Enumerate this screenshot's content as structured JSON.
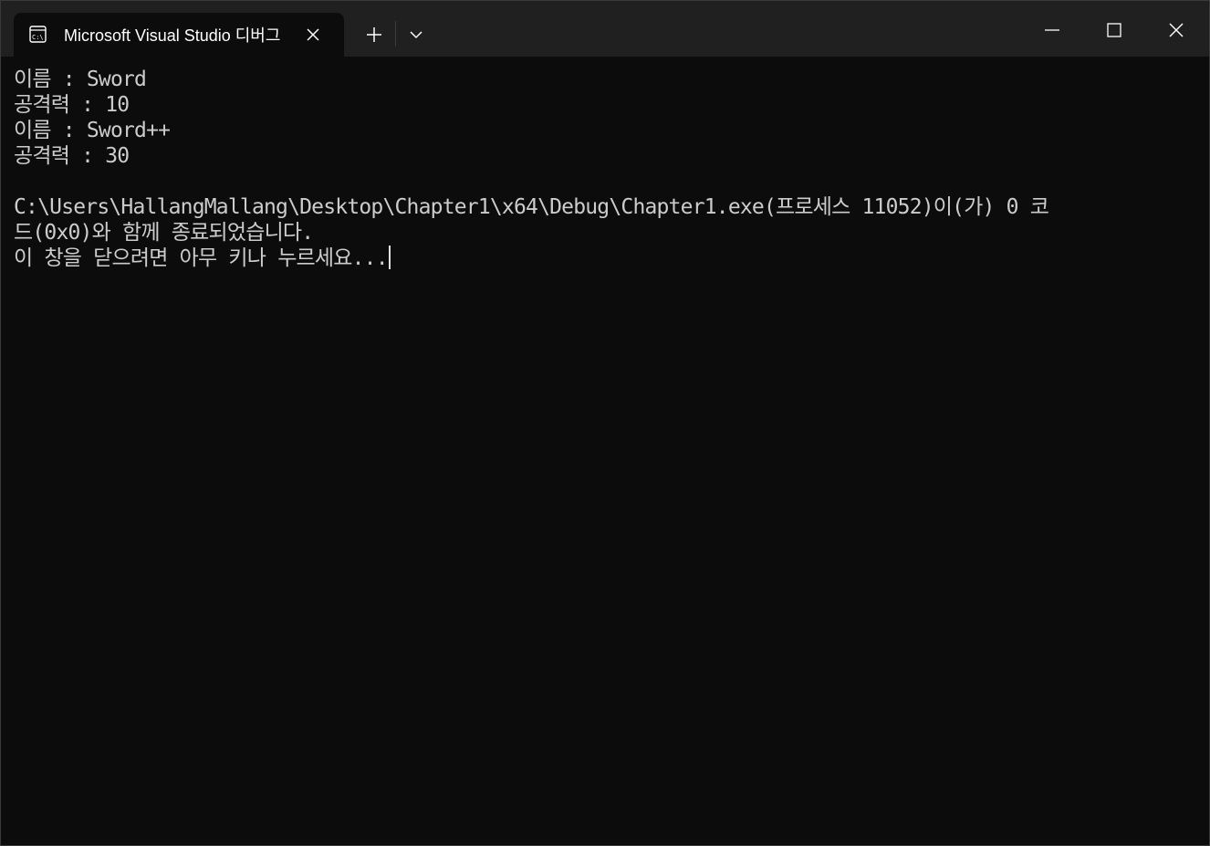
{
  "window": {
    "tab_title": "Microsoft Visual Studio 디버그",
    "icons": {
      "tab": "terminal-icon",
      "close_tab": "close-icon",
      "new_tab": "plus-icon",
      "dropdown": "chevron-down-icon",
      "minimize": "minimize-icon",
      "maximize": "maximize-icon",
      "close": "close-icon"
    }
  },
  "console": {
    "lines": [
      "이름 : Sword",
      "공격력 : 10",
      "이름 : Sword++",
      "공격력 : 30",
      "",
      "C:\\Users\\HallangMallang\\Desktop\\Chapter1\\x64\\Debug\\Chapter1.exe(프로세스 11052)이(가) 0 코",
      "드(0x0)와 함께 종료되었습니다.",
      "이 창을 닫으려면 아무 키나 누르세요..."
    ]
  },
  "colors": {
    "titlebar": "#202020",
    "console_bg": "#0c0c0c",
    "text": "#cccccc"
  }
}
